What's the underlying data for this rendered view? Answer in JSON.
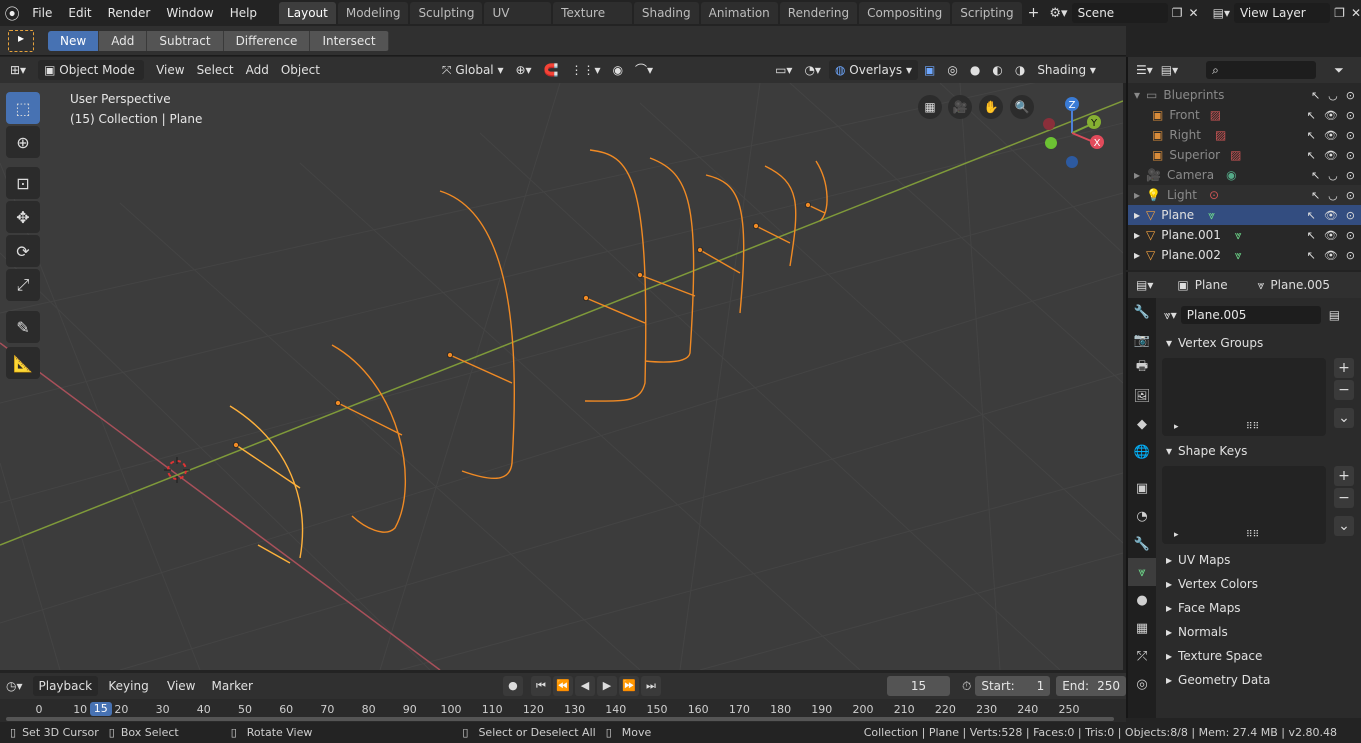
{
  "menu": [
    "File",
    "Edit",
    "Render",
    "Window",
    "Help"
  ],
  "workspaces": [
    "Layout",
    "Modeling",
    "Sculpting",
    "UV Editing",
    "Texture Paint",
    "Shading",
    "Animation",
    "Rendering",
    "Compositing",
    "Scripting"
  ],
  "scene": {
    "label": "Scene",
    "view_layer": "View Layer"
  },
  "boolean_ops": [
    "New",
    "Add",
    "Subtract",
    "Difference",
    "Intersect"
  ],
  "viewport_header": {
    "mode": "Object Mode",
    "menus": [
      "View",
      "Select",
      "Add",
      "Object"
    ],
    "orientation": "Global",
    "overlays": "Overlays",
    "shading": "Shading"
  },
  "viewport": {
    "perspective": "User Perspective",
    "collection_info": "(15) Collection | Plane"
  },
  "gizmo": {
    "z": "Z",
    "y": "Y",
    "x": "X"
  },
  "outliner": {
    "rows": [
      {
        "label": "Blueprints",
        "dim": true
      },
      {
        "label": "Front",
        "dim": true
      },
      {
        "label": "Right",
        "dim": true
      },
      {
        "label": "Superior",
        "dim": true
      },
      {
        "label": "Camera",
        "dim": true
      },
      {
        "label": "Light",
        "dim": true
      },
      {
        "label": "Plane",
        "dim": false
      },
      {
        "label": "Plane.001",
        "dim": false
      },
      {
        "label": "Plane.002",
        "dim": false
      }
    ]
  },
  "properties": {
    "object": "Plane",
    "mesh": "Plane.005",
    "data_name": "Plane.005",
    "vertex_groups": "Vertex Groups",
    "shape_keys": "Shape Keys",
    "collapsed": [
      "UV Maps",
      "Vertex Colors",
      "Face Maps",
      "Normals",
      "Texture Space",
      "Geometry Data"
    ]
  },
  "timeline": {
    "menus": [
      "Playback",
      "Keying",
      "View",
      "Marker"
    ],
    "current_frame": "15",
    "start_label": "Start:",
    "start": "1",
    "end_label": "End:",
    "end": "250",
    "ruler": [
      "0",
      "10",
      "20",
      "30",
      "40",
      "50",
      "60",
      "70",
      "80",
      "90",
      "100",
      "110",
      "120",
      "130",
      "140",
      "150",
      "160",
      "170",
      "180",
      "190",
      "200",
      "210",
      "220",
      "230",
      "240",
      "250"
    ],
    "current": "15"
  },
  "status": {
    "left": [
      "Set 3D Cursor",
      "Box Select",
      "Rotate View",
      "Select or Deselect All",
      "Move"
    ],
    "right": "Collection | Plane | Verts:528 | Faces:0 | Tris:0 | Objects:8/8 | Mem: 27.4 MB | v2.80.48"
  }
}
